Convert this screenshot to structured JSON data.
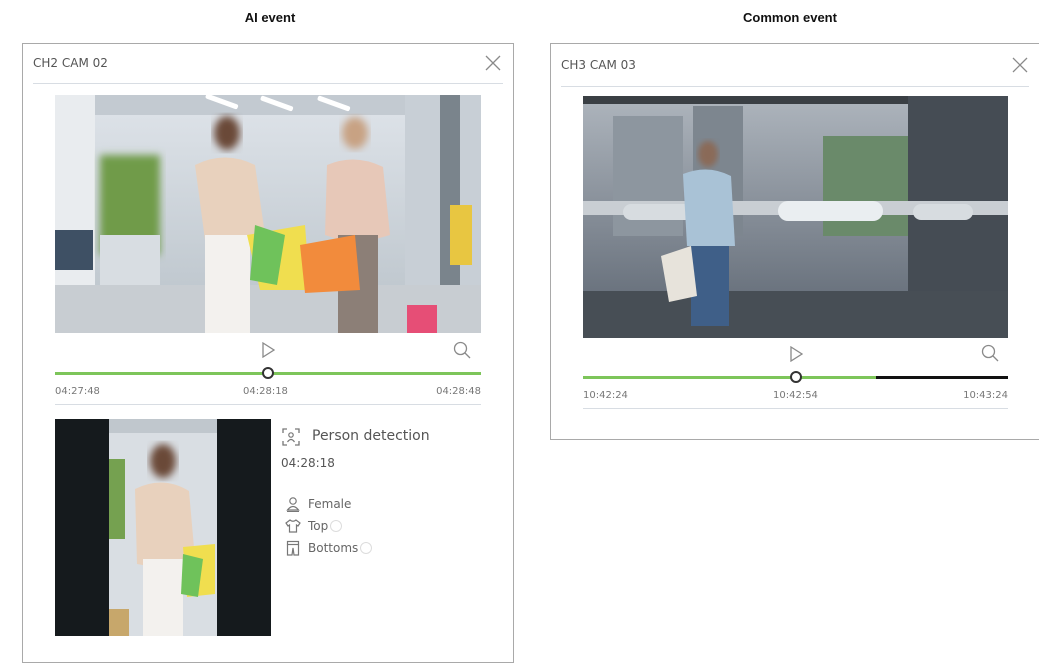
{
  "sections": {
    "ai_event_title": "AI event",
    "common_event_title": "Common event"
  },
  "ai_panel": {
    "camera_title": "CH2 CAM 02",
    "close_icon": "close-icon",
    "play_icon": "play-icon",
    "zoom_icon": "search-icon",
    "timeline": {
      "start": "04:27:48",
      "current": "04:28:18",
      "end": "04:28:48",
      "position": 0.5,
      "track_color": "#7dc55a"
    },
    "detection": {
      "icon": "object-detection-icon",
      "type": "Person detection",
      "time": "04:28:18",
      "attributes": [
        {
          "icon": "person-icon",
          "label": "Female"
        },
        {
          "icon": "shirt-icon",
          "label": "Top"
        },
        {
          "icon": "pants-icon",
          "label": "Bottoms"
        }
      ]
    }
  },
  "common_panel": {
    "camera_title": "CH3 CAM 03",
    "close_icon": "close-icon",
    "play_icon": "play-icon",
    "zoom_icon": "search-icon",
    "timeline": {
      "start": "10:42:24",
      "current": "10:42:54",
      "end": "10:43:24",
      "position": 0.5,
      "recorded_until": 0.69,
      "track_color": "#7dc55a",
      "unrecorded_color": "#111111"
    }
  }
}
